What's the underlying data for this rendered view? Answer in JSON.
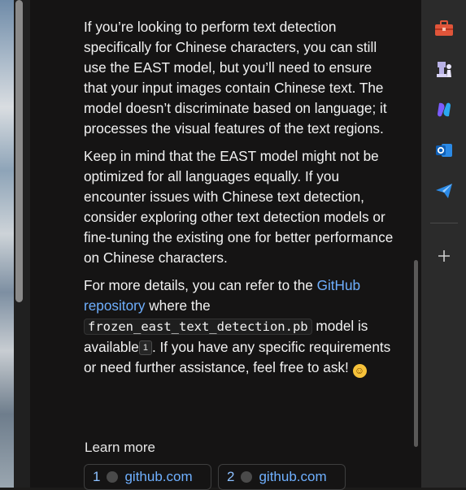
{
  "chat": {
    "paragraphs": [
      "If you’re looking to perform text detection specifically for Chinese characters, you can still use the EAST model, but you’ll need to ensure that your input images contain Chinese text. The model doesn’t discriminate based on language; it processes the visual features of the text regions.",
      "Keep in mind that the EAST model might not be optimized for all languages equally. If you encounter issues with Chinese text detection, consider exploring other text detection models or fine-tuning the existing one for better performance on Chinese characters."
    ],
    "details": {
      "prefix": "For more details, you can refer to the ",
      "link_text": "GitHub repository",
      "mid": " where the ",
      "code": "frozen_east_text_detection.pb",
      "suffix_a": " model is available",
      "citation": "1",
      "suffix_b": ". If you have any specific requirements or need further assistance, feel free to ask! ",
      "emoji": "😊"
    },
    "learn_more_label": "Learn more",
    "sources": [
      {
        "num": "1",
        "label": "github.com"
      },
      {
        "num": "2",
        "label": "github.com"
      }
    ]
  },
  "sidebar": {
    "icons": [
      "toolbox-icon",
      "chess-icon",
      "copilot-icon",
      "outlook-icon",
      "send-icon",
      "plus-icon"
    ]
  },
  "colors": {
    "link": "#6fb0ff",
    "panel_bg": "#151414",
    "sidebar_bg": "#2b2b2b"
  }
}
